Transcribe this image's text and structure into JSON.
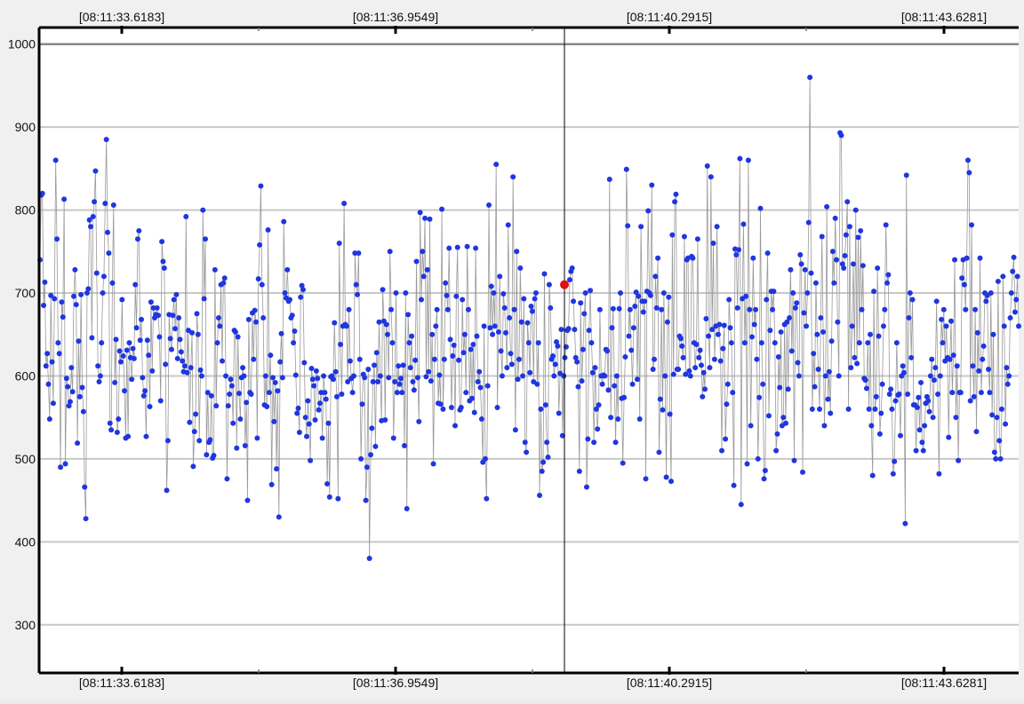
{
  "chart_data": {
    "type": "scatter",
    "title": "",
    "xlabel": "",
    "ylabel": "",
    "x_tick_labels": [
      "[08:11:33.6183]",
      "[08:11:36.9549]",
      "[08:11:40.2915]",
      "[08:11:43.6281]"
    ],
    "y_ticks": [
      300,
      400,
      500,
      600,
      700,
      800,
      900,
      1000
    ],
    "ylim": [
      242,
      1020
    ],
    "grid": true,
    "highlighted_point": {
      "y": 710
    },
    "series": [
      {
        "connected": true,
        "values": [
          740,
          818,
          820,
          685,
          713,
          612,
          627,
          590,
          548,
          697,
          617,
          567,
          693,
          860,
          765,
          640,
          627,
          490,
          689,
          671,
          813,
          494,
          597,
          587,
          564,
          569,
          610,
          581,
          696,
          728,
          686,
          519,
          642,
          575,
          698,
          586,
          557,
          466,
          428,
          700,
          705,
          788,
          780,
          646,
          792,
          810,
          847,
          724,
          612,
          593,
          600,
          640,
          700,
          720,
          808,
          885,
          773,
          748,
          543,
          535,
          712,
          806,
          592,
          644,
          532,
          548,
          630,
          617,
          692,
          624,
          582,
          525,
          631,
          527,
          640,
          622,
          596,
          633,
          621,
          710,
          658,
          765,
          775,
          643,
          668,
          598,
          576,
          582,
          527,
          643,
          625,
          563,
          689,
          606,
          682,
          670,
          674,
          682,
          673,
          647,
          570,
          762,
          738,
          730,
          614,
          462,
          522,
          674,
          645,
          632,
          673,
          692,
          657,
          698,
          621,
          670,
          644,
          629,
          618,
          605,
          612,
          792,
          604,
          655,
          544,
          610,
          652,
          491,
          533,
          554,
          675,
          650,
          522,
          607,
          600,
          800,
          693,
          765,
          505,
          580,
          520,
          523,
          576,
          501,
          504,
          728,
          564,
          640,
          670,
          660,
          710,
          618,
          712,
          718,
          600,
          476,
          564,
          578,
          596,
          588,
          543,
          655,
          653,
          513,
          647,
          579,
          548,
          598,
          610,
          600,
          516,
          568,
          450,
          668,
          580,
          578,
          676,
          620,
          679,
          665,
          525,
          717,
          758,
          829,
          710,
          670,
          565,
          600,
          563,
          776,
          580,
          625,
          469,
          598,
          545,
          592,
          488,
          582,
          430,
          617,
          651,
          598,
          786,
          700,
          694,
          728,
          690,
          692,
          670,
          673,
          640,
          654,
          601,
          555,
          561,
          532,
          695,
          709,
          704,
          616,
          550,
          527,
          570,
          542,
          498,
          609,
          596,
          588,
          547,
          606,
          597,
          559,
          567,
          580,
          525,
          600,
          580,
          572,
          470,
          543,
          454,
          599,
          600,
          596,
          664,
          605,
          575,
          452,
          760,
          638,
          578,
          660,
          808,
          662,
          660,
          593,
          680,
          618,
          597,
          580,
          600,
          748,
          710,
          698,
          748,
          620,
          500,
          566,
          602,
          598,
          450,
          490,
          608,
          380,
          505,
          537,
          593,
          613,
          515,
          628,
          593,
          665,
          600,
          546,
          704,
          666,
          547,
          662,
          650,
          598,
          750,
          680,
          640,
          525,
          593,
          700,
          580,
          612,
          590,
          597,
          580,
          613,
          516,
          700,
          440,
          674,
          640,
          610,
          648,
          593,
          583,
          619,
          738,
          598,
          545,
          797,
          692,
          750,
          720,
          790,
          599,
          728,
          605,
          789,
          594,
          650,
          494,
          620,
          660,
          680,
          567,
          601,
          566,
          801,
          560,
          620,
          712,
          697,
          680,
          754,
          644,
          562,
          624,
          637,
          540,
          696,
          755,
          619,
          559,
          562,
          692,
          628,
          650,
          580,
          756,
          680,
          570,
          632,
          573,
          638,
          556,
          754,
          648,
          593,
          605,
          586,
          548,
          496,
          660,
          500,
          452,
          588,
          806,
          658,
          708,
          650,
          700,
          660,
          855,
          562,
          653,
          720,
          630,
          600,
          699,
          682,
          652,
          610,
          782,
          670,
          627,
          614,
          840,
          680,
          535,
          750,
          596,
          620,
          730,
          665,
          600,
          693,
          520,
          508,
          664,
          640,
          604,
          684,
          678,
          593,
          693,
          700,
          590,
          640,
          456,
          560,
          485,
          496,
          723,
          565,
          520,
          502,
          710,
          682,
          620,
          624,
          600,
          614,
          641,
          636,
          555,
          603,
          656,
          528,
          600,
          622,
          635,
          655,
          657,
          716,
          726,
          730,
          690,
          656,
          622,
          617,
          587,
          485,
          688,
          594,
          632,
          675,
          700,
          466,
          524,
          655,
          703,
          640,
          604,
          520,
          610,
          560,
          536,
          565,
          680,
          600,
          590,
          601,
          600,
          632,
          630,
          583,
          837,
          550,
          658,
          681,
          588,
          520,
          600,
          548,
          681,
          700,
          573,
          495,
          574,
          623,
          849,
          781,
          648,
          680,
          631,
          590,
          658,
          684,
          701,
          596,
          696,
          548,
          780,
          690,
          677,
          690,
          476,
          702,
          799,
          700,
          697,
          830,
          608,
          620,
          720,
          682,
          742,
          508,
          572,
          680,
          559,
          700,
          600,
          478,
          665,
          695,
          554,
          473,
          770,
          602,
          810,
          819,
          608,
          608,
          648,
          645,
          636,
          622,
          768,
          602,
          740,
          742,
          606,
          600,
          744,
          742,
          640,
          610,
          638,
          765,
          622,
          631,
          613,
          575,
          604,
          584,
          669,
          853,
          648,
          610,
          840,
          656,
          760,
          620,
          660,
          780,
          650,
          662,
          618,
          510,
          633,
          661,
          524,
          566,
          590,
          692,
          658,
          640,
          580,
          468,
          753,
          746,
          682,
          752,
          862,
          445,
          693,
          783,
          640,
          696,
          494,
          860,
          680,
          540,
          647,
          742,
          662,
          680,
          620,
          500,
          574,
          802,
          640,
          590,
          476,
          486,
          692,
          748,
          552,
          655,
          702,
          680,
          702,
          640,
          510,
          530,
          623,
          586,
          653,
          540,
          550,
          662,
          543,
          665,
          584,
          670,
          728,
          630,
          700,
          498,
          682,
          688,
          616,
          600,
          746,
          735,
          484,
          676,
          728,
          660,
          700,
          785,
          960,
          724,
          560,
          627,
          587,
          712,
          650,
          608,
          560,
          670,
          768,
          653,
          540,
          600,
          804,
          572,
          605,
          555,
          642,
          750,
          712,
          790,
          740,
          665,
          600,
          893,
          890,
          735,
          730,
          745,
          770,
          810,
          560,
          780,
          610,
          660,
          735,
          622,
          800,
          615,
          767,
          640,
          775,
          680,
          733,
          597,
          595,
          585,
          640,
          560,
          650,
          540,
          480,
          702,
          560,
          575,
          730,
          648,
          530,
          555,
          590,
          660,
          680,
          782,
          712,
          722,
          578,
          584,
          560,
          482,
          497,
          570,
          640,
          577,
          578,
          528,
          600,
          612,
          604,
          422,
          842,
          578,
          670,
          700,
          622,
          692,
          565,
          565,
          510,
          562,
          574,
          535,
          592,
          520,
          510,
          540,
          567,
          575,
          570,
          557,
          600,
          620,
          550,
          595,
          610,
          690,
          578,
          482,
          600,
          668,
          640,
          680,
          618,
          660,
          622,
          526,
          620,
          666,
          580,
          625,
          740,
          550,
          612,
          498,
          580,
          580,
          718,
          740,
          710,
          680,
          742,
          860,
          845,
          570,
          782,
          612,
          575,
          680,
          533,
          652,
          606,
          742,
          580,
          620,
          636,
          700,
          690,
          697,
          608,
          580,
          700,
          553,
          650,
          508,
          500,
          550,
          714,
          522,
          500,
          560,
          720,
          660,
          542,
          610,
          590,
          600,
          670,
          700,
          726,
          743,
          677,
          692,
          720,
          660
        ]
      }
    ]
  }
}
